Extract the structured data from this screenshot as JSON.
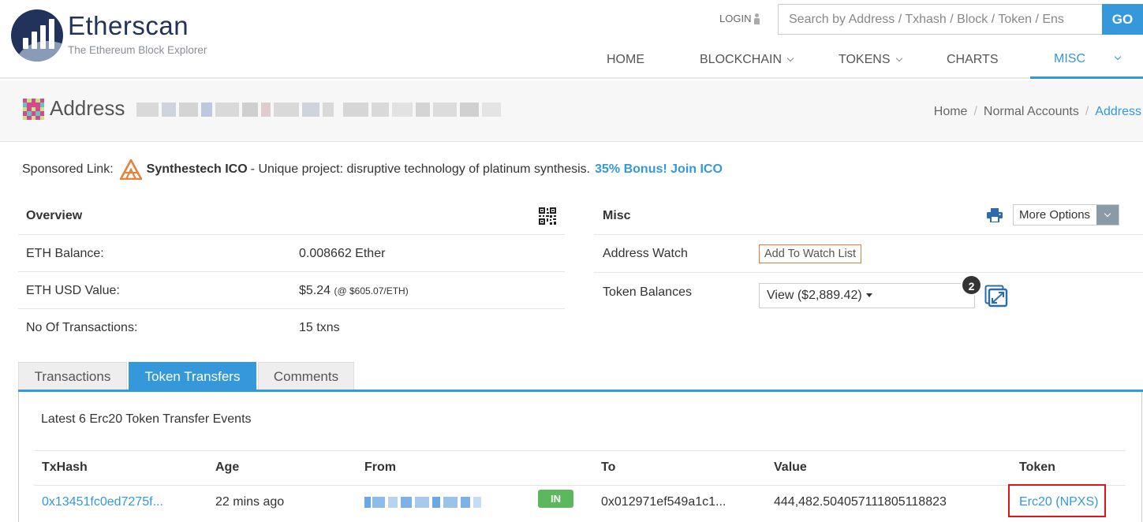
{
  "header": {
    "logo_name": "Etherscan",
    "logo_tagline": "The Ethereum Block Explorer",
    "login_label": "LOGIN",
    "search_placeholder": "Search by Address / Txhash / Block / Token / Ens",
    "go_label": "GO",
    "nav": [
      {
        "label": "HOME",
        "active": false
      },
      {
        "label": "BLOCKCHAIN",
        "active": false
      },
      {
        "label": "TOKENS",
        "active": false
      },
      {
        "label": "CHARTS",
        "active": false
      },
      {
        "label": "MISC",
        "active": true
      }
    ]
  },
  "title": {
    "label": "Address",
    "breadcrumb": [
      "Home",
      "Normal Accounts",
      "Address"
    ]
  },
  "sponsored": {
    "prefix": "Sponsored Link:",
    "name": "Synthestech ICO",
    "text": "- Unique project: disruptive technology of platinum synthesis.",
    "bonus": "35% Bonus! Join ICO"
  },
  "overview": {
    "title": "Overview",
    "rows": [
      {
        "label": "ETH Balance:",
        "value": "0.008662 Ether",
        "note": ""
      },
      {
        "label": "ETH USD Value:",
        "value": "$5.24",
        "note": "(@ $605.07/ETH)"
      },
      {
        "label": "No Of Transactions:",
        "value": "15 txns",
        "note": ""
      }
    ]
  },
  "misc": {
    "title": "Misc",
    "more_options": "More Options",
    "address_watch_label": "Address Watch",
    "watch_button": "Add To Watch List",
    "token_balances_label": "Token Balances",
    "token_balances_value": "View ($2,889.42)",
    "token_count_badge": "2"
  },
  "tabs": [
    {
      "label": "Transactions",
      "active": false
    },
    {
      "label": "Token Transfers",
      "active": true
    },
    {
      "label": "Comments",
      "active": false
    }
  ],
  "transfers": {
    "heading": "Latest 6 Erc20 Token Transfer Events",
    "columns": [
      "TxHash",
      "Age",
      "From",
      "To",
      "Value",
      "Token"
    ],
    "rows": [
      {
        "txhash": "0x13451fc0ed7275f...",
        "age": "22 mins ago",
        "direction": "IN",
        "to": "0x012971ef549a1c1...",
        "value": "444,482.504057111805118823",
        "token": "Erc20 (NPXS)"
      }
    ]
  },
  "colors": {
    "accent": "#3498db",
    "brand_navy": "#21325b",
    "in_badge": "#5cb85c",
    "highlight": "#e0141e",
    "watch_border": "#e07b39"
  }
}
